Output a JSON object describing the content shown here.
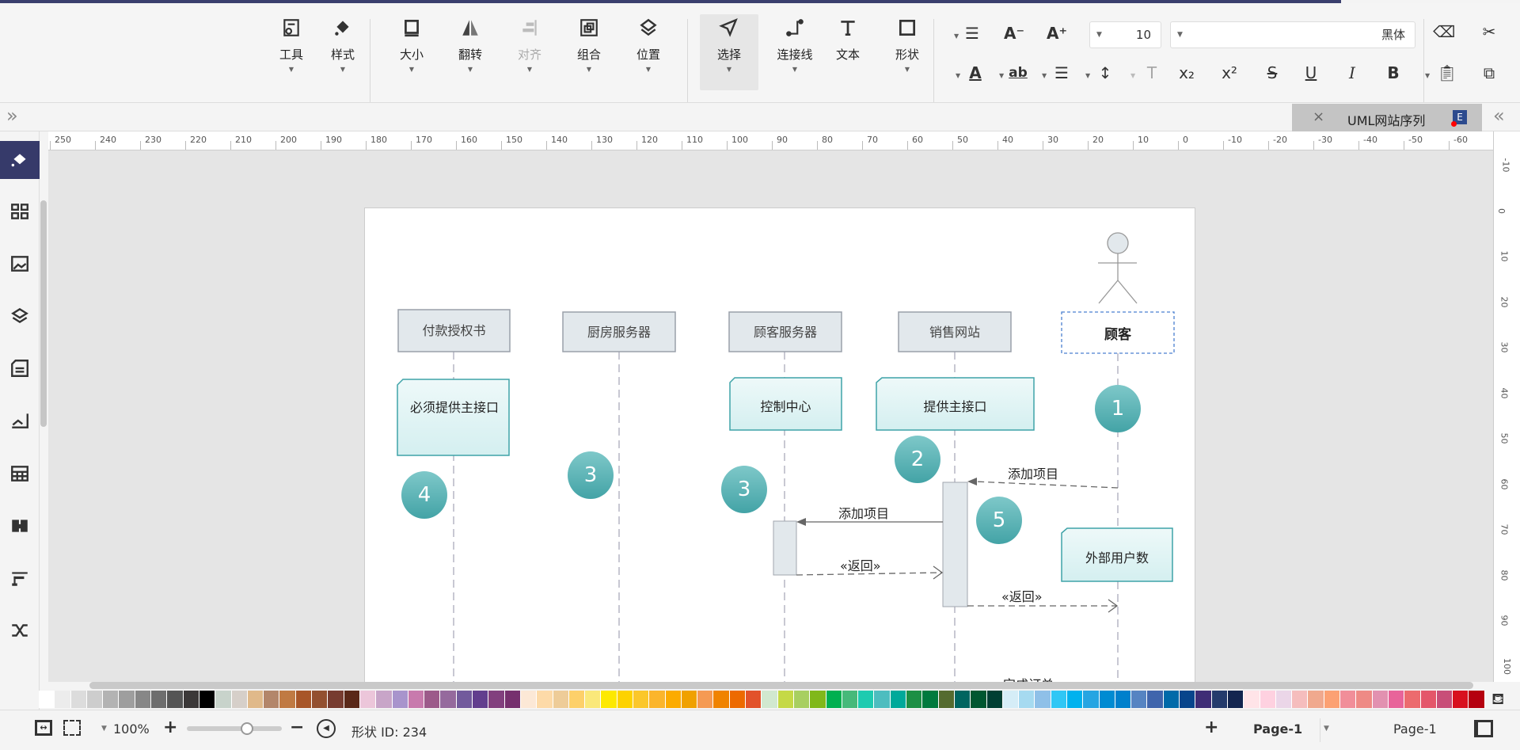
{
  "toolbar": {
    "tools_label": "工具",
    "style_label": "样式",
    "size_label": "大小",
    "flip_label": "翻转",
    "align_label": "对齐",
    "group_label": "组合",
    "position_label": "位置",
    "select_label": "选择",
    "connector_label": "连接线",
    "text_label": "文本",
    "shape_label": "形状",
    "font_size": "10",
    "font_name": "黑体"
  },
  "tab": {
    "title": "UML网站序列",
    "close": "×"
  },
  "ruler": {
    "h_ticks": [
      "250",
      "240",
      "230",
      "220",
      "210",
      "200",
      "190",
      "180",
      "170",
      "160",
      "150",
      "140",
      "130",
      "120",
      "110",
      "100",
      "90",
      "80",
      "70",
      "60",
      "50",
      "40",
      "30",
      "20",
      "10",
      "0",
      "-10",
      "-20",
      "-30",
      "-40",
      "-50",
      "-60"
    ],
    "v_ticks": [
      "-10",
      "0",
      "10",
      "20",
      "30",
      "40",
      "50",
      "60",
      "70",
      "80",
      "90",
      "100"
    ]
  },
  "diagram": {
    "lifelines": [
      "付款授权书",
      "厨房服务器",
      "顾客服务器",
      "销售网站"
    ],
    "actor": "顾客",
    "notes": [
      "必须提供主接口",
      "控制中心",
      "提供主接口",
      "外部用户数"
    ],
    "steps": [
      "1",
      "2",
      "3",
      "3",
      "4",
      "5"
    ],
    "messages": [
      "添加项目",
      "添加项目",
      "«返回»",
      "«返回»",
      "完成订单"
    ]
  },
  "palette": [
    "#ffffff",
    "#ececec",
    "#dcdcdc",
    "#cdcdcd",
    "#b3b3b3",
    "#9e9e9e",
    "#878787",
    "#6e6e6e",
    "#555555",
    "#3b3838",
    "#000000",
    "#c8d3cb",
    "#d6cfc9",
    "#e0b98a",
    "#b3866a",
    "#c07a43",
    "#a85628",
    "#935030",
    "#773c30",
    "#5a2818",
    "#ecc6da",
    "#c8a5c8",
    "#a894cc",
    "#c87aad",
    "#9c5a8a",
    "#956a9d",
    "#725a9c",
    "#623e8e",
    "#82407e",
    "#76306e",
    "#fce8d6",
    "#fddaa8",
    "#eecc98",
    "#fdd06a",
    "#fae87a",
    "#fde900",
    "#fdd200",
    "#fbc72a",
    "#fbb52c",
    "#fcab00",
    "#f0a100",
    "#f59a53",
    "#f08300",
    "#ed6a00",
    "#e2522a",
    "#d1e8cf",
    "#c5d946",
    "#a8cf60",
    "#80b81a",
    "#00b050",
    "#46b97a",
    "#1ecbb0",
    "#4dbdbf",
    "#00a99a",
    "#1c8f44",
    "#007a3d",
    "#556b2f",
    "#006560",
    "#005730",
    "#003f33",
    "#d5edf7",
    "#a6daf0",
    "#8fc0e8",
    "#2fc7f5",
    "#00b2ee",
    "#26a5e2",
    "#008bd2",
    "#0080cc",
    "#5684c2",
    "#4065ac",
    "#006aa9",
    "#08458c",
    "#3f2d76",
    "#243b6c",
    "#13254f",
    "#ffe4e8",
    "#fed1e0",
    "#ebd6e8",
    "#f5bdbd",
    "#f0a98e",
    "#fca173",
    "#f18e99",
    "#ee8a85",
    "#e291b0",
    "#e8649a",
    "#ec6b6e",
    "#e4566a",
    "#c84e78",
    "#d8101e",
    "#b5000f"
  ],
  "status": {
    "shape_id": "形状 ID: 234",
    "zoom": "100%",
    "zoom_level": 50,
    "page_tab": "Page-1",
    "page_label": "Page-1"
  },
  "colors": {
    "accent": "#363a6a",
    "note_border": "#3fa3a8",
    "step_circle": "#4aa8ab"
  }
}
